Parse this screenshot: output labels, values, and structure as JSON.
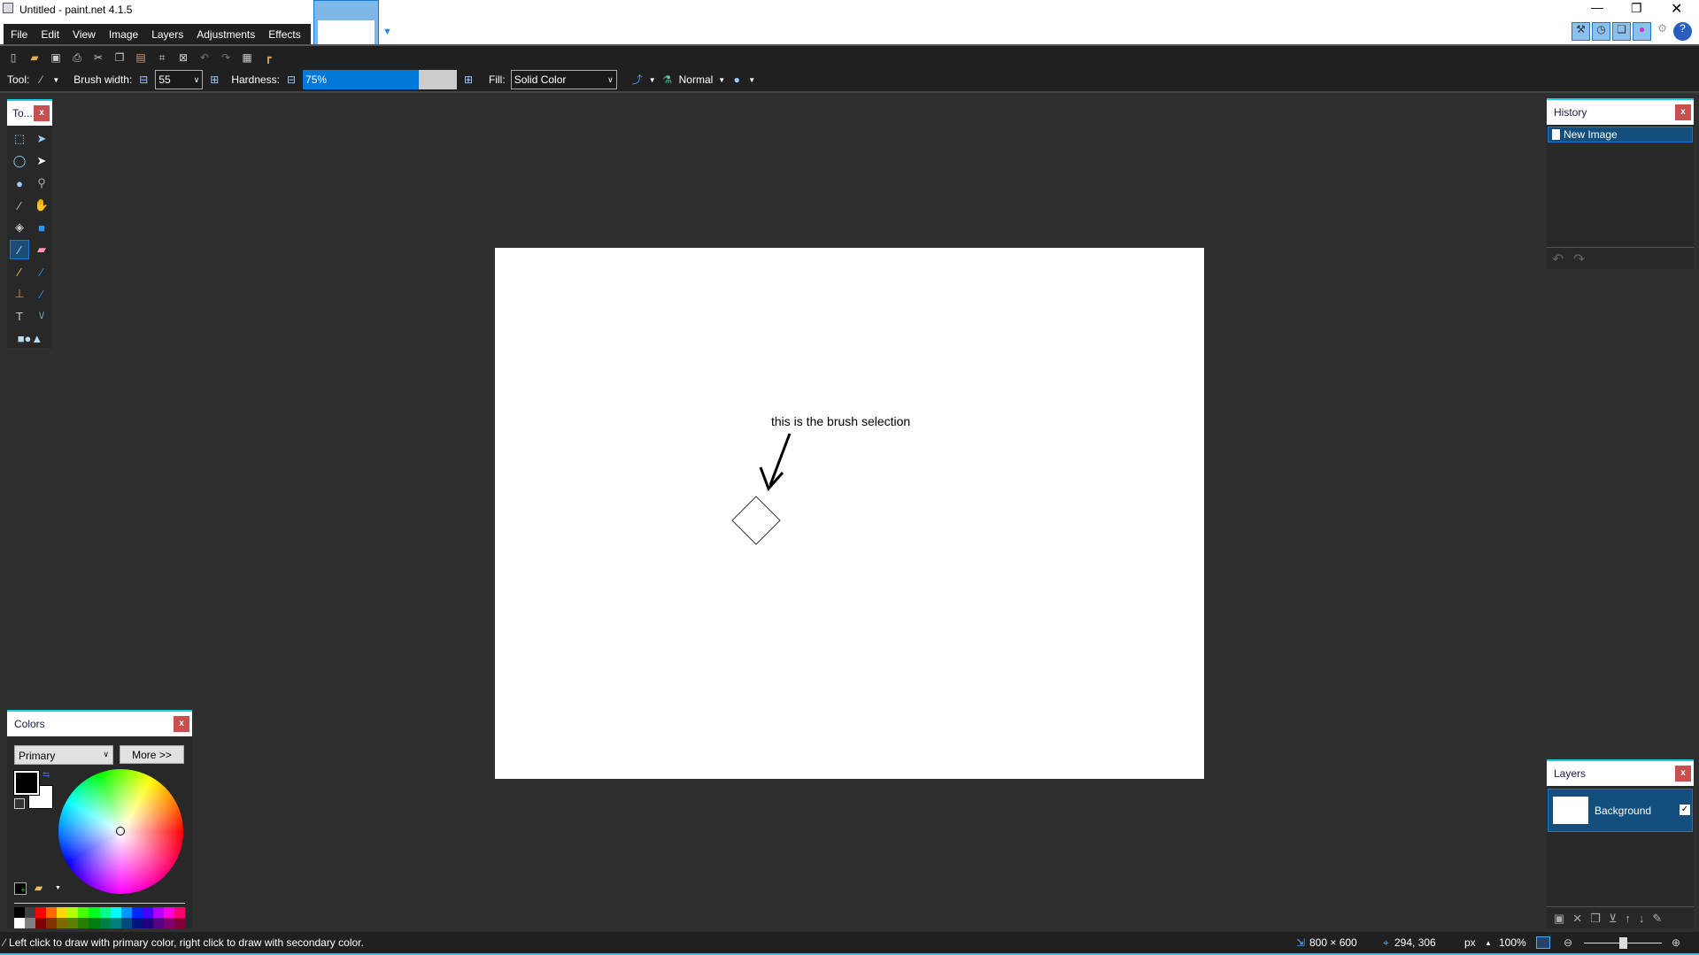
{
  "window": {
    "title": "Untitled - paint.net 4.1.5"
  },
  "menu": [
    "File",
    "Edit",
    "View",
    "Image",
    "Layers",
    "Adjustments",
    "Effects"
  ],
  "toolbar": {
    "tool_label": "Tool:",
    "brush_width_label": "Brush width:",
    "brush_width": "55",
    "hardness_label": "Hardness:",
    "hardness": "75%",
    "hardness_value": 75,
    "fill_label": "Fill:",
    "fill": "Solid Color",
    "blend_mode": "Normal"
  },
  "tools_panel": {
    "title": "To..."
  },
  "colors_panel": {
    "title": "Colors",
    "mode": "Primary",
    "more_button": "More >>",
    "primary": "#000000",
    "secondary": "#ffffff",
    "palette_top": [
      "#000000",
      "#404040",
      "#ff0000",
      "#ff6a00",
      "#ffd800",
      "#b6ff00",
      "#4cff00",
      "#00ff21",
      "#00ff90",
      "#00ffff",
      "#0094ff",
      "#0026ff",
      "#4800ff",
      "#b200ff",
      "#ff00dc",
      "#ff006e"
    ],
    "palette_bottom": [
      "#ffffff",
      "#808080",
      "#7f0000",
      "#7f3300",
      "#7f6a00",
      "#5b7f00",
      "#267f00",
      "#007f0e",
      "#007f46",
      "#007f7f",
      "#004a7f",
      "#00137f",
      "#21007f",
      "#57007f",
      "#7f006e",
      "#7f0037"
    ]
  },
  "history_panel": {
    "title": "History",
    "items": [
      "New Image"
    ]
  },
  "layers_panel": {
    "title": "Layers",
    "layers": [
      {
        "name": "Background",
        "visible": true
      }
    ]
  },
  "canvas": {
    "annotation": "this is the brush selection"
  },
  "status": {
    "hint": "Left click to draw with primary color, right click to draw with secondary color.",
    "image_size": "800 × 600",
    "cursor_pos": "294, 306",
    "units": "px",
    "zoom": "100%"
  },
  "accent": "#1a78d2"
}
